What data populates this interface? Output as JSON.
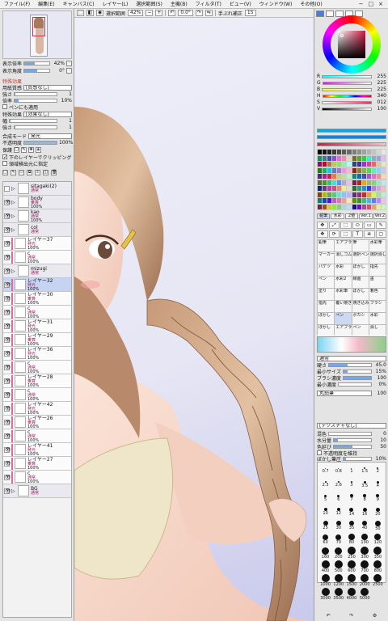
{
  "menu": [
    "ファイル(F)",
    "編集(E)",
    "キャンバス(C)",
    "レイヤー(L)",
    "選択範囲(S)",
    "主機(B)",
    "フィルタ(T)",
    "ビュー(V)",
    "ウィンドウ(W)",
    "その他(O)"
  ],
  "window_controls": [
    "−",
    "□",
    "×"
  ],
  "toolbar": {
    "selection_source_label": "選択範囲",
    "zoom": "42%",
    "rotation": "0.0°",
    "stabilizer_label": "手ぶれ補正",
    "stabilizer_value": "15"
  },
  "navigator": {
    "zoom_label": "表示倍率",
    "zoom_value": "42%",
    "angle_label": "表示角度",
    "angle_value": "0°"
  },
  "layer_props": {
    "section_label": "特殊効果",
    "paper_label": "用紙質感",
    "paper_value": "[質感なし]",
    "strength_label": "強さ",
    "strength_value": "1",
    "scale_label": "倍率",
    "scale_value": "10%",
    "pen_label": "ペンにも適用",
    "effect_label": "特殊効果",
    "effect_value": "[効果なし]",
    "width_label": "幅",
    "width_value": "1",
    "strength2_label": "強さ",
    "strength2_value": "1",
    "blend_label": "合成モード",
    "blend_value": "発光",
    "opacity_label": "不透明度",
    "opacity_value": "100%",
    "protect_label": "保護",
    "clip_label": "下のレイヤーでクリッピング",
    "ref_label": "領域検出元に指定"
  },
  "layers": [
    {
      "name": "sitagaki(2)",
      "mode": "通常",
      "opacity": "",
      "folder": true
    },
    {
      "name": "body",
      "mode": "乗算",
      "opacity": "100%",
      "folder": true
    },
    {
      "name": "kao",
      "mode": "通常",
      "opacity": "100%",
      "folder": true
    },
    {
      "name": "col",
      "mode": "通常",
      "opacity": "",
      "folder": true
    },
    {
      "name": "レイヤー37",
      "mode": "発光",
      "opacity": "100%",
      "folder": false
    },
    {
      "name": "c",
      "mode": "通常",
      "opacity": "100%",
      "folder": false
    },
    {
      "name": "mizugi",
      "mode": "通常",
      "opacity": "",
      "folder": true
    },
    {
      "name": "レイヤー32",
      "mode": "発光",
      "opacity": "100%",
      "folder": false
    },
    {
      "name": "レイヤー30",
      "mode": "乗算",
      "opacity": "100%",
      "folder": false
    },
    {
      "name": "c",
      "mode": "通常",
      "opacity": "100%",
      "folder": false
    },
    {
      "name": "レイヤー31",
      "mode": "発光",
      "opacity": "100%",
      "folder": false
    },
    {
      "name": "レイヤー29",
      "mode": "乗算",
      "opacity": "100%",
      "folder": false
    },
    {
      "name": "レイヤー36",
      "mode": "発光",
      "opacity": "100%",
      "folder": false
    },
    {
      "name": "c",
      "mode": "通常",
      "opacity": "100%",
      "folder": false
    },
    {
      "name": "レイヤー28",
      "mode": "乗算",
      "opacity": "100%",
      "folder": false
    },
    {
      "name": "c",
      "mode": "通常",
      "opacity": "100%",
      "folder": false
    },
    {
      "name": "レイヤー42",
      "mode": "発光",
      "opacity": "100%",
      "folder": false
    },
    {
      "name": "レイヤー26",
      "mode": "乗算",
      "opacity": "100%",
      "folder": false
    },
    {
      "name": "c",
      "mode": "通常",
      "opacity": "100%",
      "folder": false
    },
    {
      "name": "レイヤー41",
      "mode": "発光",
      "opacity": "100%",
      "folder": false
    },
    {
      "name": "レイヤー27",
      "mode": "乗算",
      "opacity": "100%",
      "folder": false
    },
    {
      "name": "c",
      "mode": "通常",
      "opacity": "100%",
      "folder": false
    },
    {
      "name": "BG",
      "mode": "通常",
      "opacity": "",
      "folder": true
    }
  ],
  "color": {
    "current": "#d01a48",
    "rows": [
      {
        "label": "R",
        "value": "255",
        "gradient": "linear-gradient(to right,#00ffff,#ffffff)"
      },
      {
        "label": "G",
        "value": "225",
        "gradient": "linear-gradient(to right,#ff00ff,#ffffff)"
      },
      {
        "label": "B",
        "value": "225",
        "gradient": "linear-gradient(to right,#ffff00,#ffffff)"
      },
      {
        "label": "H",
        "value": "340",
        "gradient": "linear-gradient(to right,red,yellow,lime,cyan,blue,magenta,red)"
      },
      {
        "label": "S",
        "value": "012",
        "gradient": "linear-gradient(to right,#ffffff,#ff2060)"
      },
      {
        "label": "V",
        "value": "100",
        "gradient": "linear-gradient(to right,#000000,#ffffff)"
      }
    ]
  },
  "tool_tabs": [
    "鉛筆",
    "水彩",
    "2値",
    "Ver.1",
    "Ver.2"
  ],
  "tool_icons": [
    "✥",
    "⤢",
    "⬚",
    "⬭",
    "▭",
    "✎",
    "✥",
    "⟳",
    "⬚",
    "T",
    "⎈",
    "▢"
  ],
  "brushes": [
    "鉛筆",
    "エアブラシ",
    "筆",
    "水彩筆",
    "マーカー",
    "消しゴム",
    "選択ペン",
    "選択消し",
    "バケツ",
    "水彩",
    "ぼかし",
    "指先",
    "ペン",
    "水彩2",
    "線画",
    "墨",
    "塗り",
    "水彩筆",
    "ぼかし",
    "着色",
    "指先",
    "覆い焼き",
    "焼き込み",
    "ブラシ",
    "ぼかし",
    "ペン",
    "ボカシ",
    "水彩",
    "ぼかし",
    "エアブラシ",
    "ペン",
    "消し"
  ],
  "brush_props": {
    "blend_label": "通常",
    "hardness_label": "硬さ",
    "hardness_value": "45.0",
    "size_label": "最小サイズ",
    "size_value": "15%",
    "density_label": "ブラシ濃度",
    "density_value": "100",
    "min_density_label": "最小濃度",
    "min_density_value": "0%",
    "shape_label": "丸鉛筆",
    "shape_value": "100",
    "texture_label": "[テクスチャなし]",
    "mix_label": "混色",
    "mix_value": "0",
    "water_label": "水分量",
    "water_value": "10",
    "persist_label": "色延び",
    "persist_value": "50",
    "keep_label": "不透明度を維持",
    "blur_label": "ぼかし筆圧",
    "blur_value": "10%"
  },
  "brush_sizes": [
    "0.7",
    "0.8",
    "1",
    "1.5",
    "2",
    "2.3",
    "2.6",
    "3",
    "3.5",
    "4",
    "5",
    "6",
    "7",
    "8",
    "9",
    "10",
    "12",
    "14",
    "16",
    "20",
    "25",
    "30",
    "35",
    "40",
    "50",
    "60",
    "70",
    "80",
    "100",
    "120",
    "160",
    "200",
    "250",
    "300",
    "350",
    "400",
    "500",
    "600",
    "700",
    "800",
    "1000",
    "1200",
    "1500",
    "2000",
    "2500",
    "3000",
    "3500",
    "4000",
    "5000"
  ]
}
